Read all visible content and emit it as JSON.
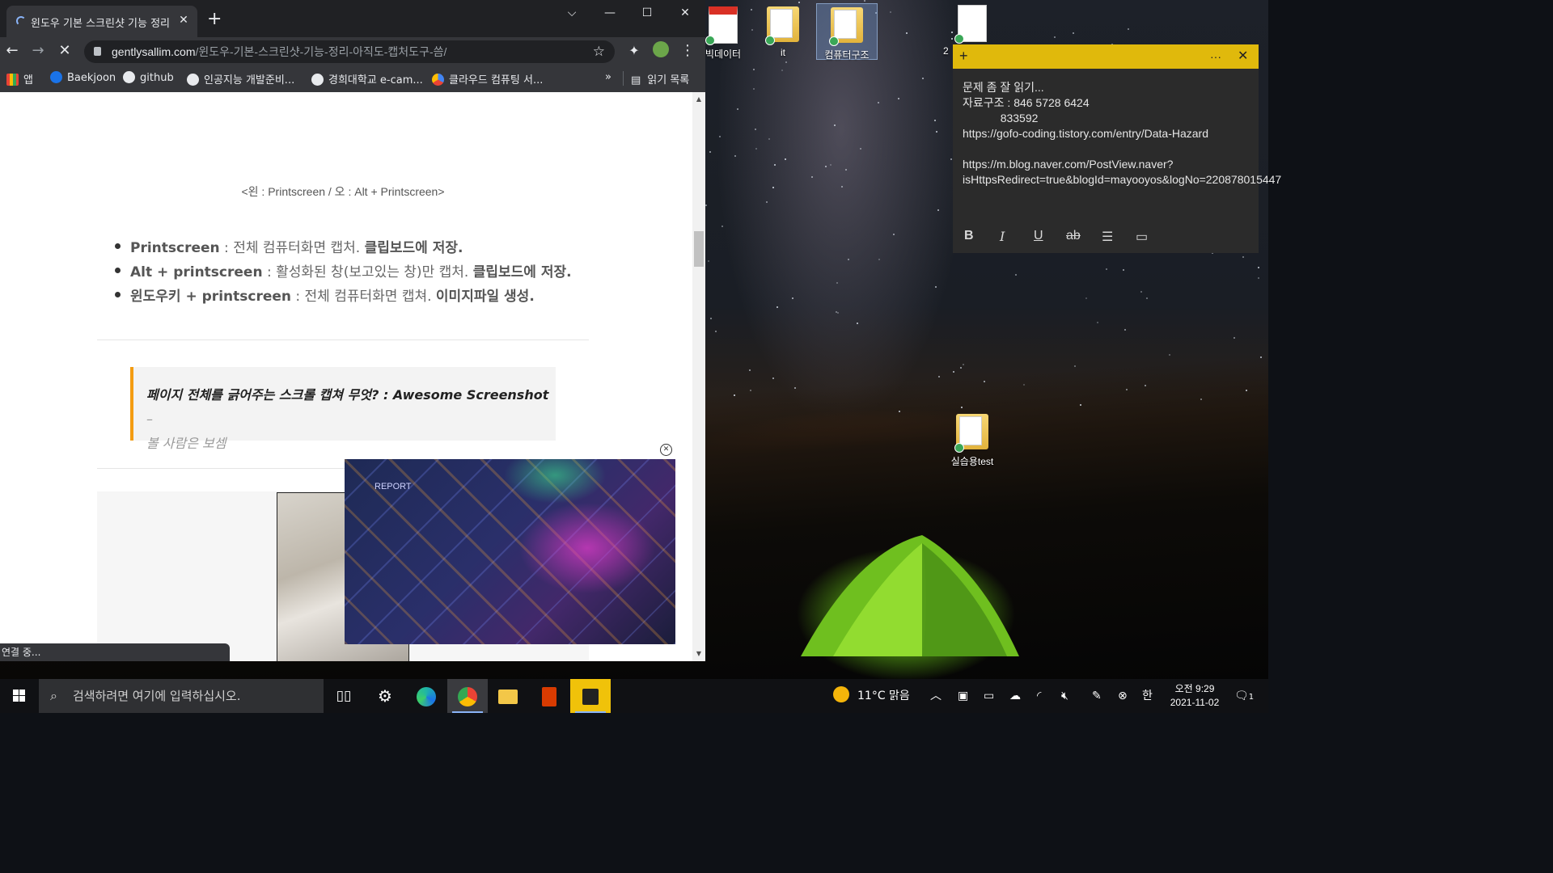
{
  "browser": {
    "tab_title": "윈도우 기본 스크린샷 기능 정리",
    "tab_close": "✕",
    "new_tab": "+",
    "window_controls": {
      "dropdown": "⌵",
      "minimize": "—",
      "maximize": "☐",
      "close": "✕"
    },
    "nav": {
      "back": "←",
      "forward": "→",
      "stop": "✕"
    },
    "url_host": "gentlysallim.com",
    "url_path": "/윈도우-기본-스크린샷-기능-정리-아직도-캡처도구-씀/",
    "bookmark_star": "☆",
    "bookmarks": [
      {
        "label": "앱",
        "icon": "apps-grid-icon"
      },
      {
        "label": "Baekjoon",
        "icon": "code-icon"
      },
      {
        "label": "github",
        "icon": "github-icon"
      },
      {
        "label": "인공지능 개발준비...",
        "icon": "globe-icon"
      },
      {
        "label": "경희대학교 e-cam...",
        "icon": "globe-icon"
      },
      {
        "label": "클라우드 컴퓨팅 서...",
        "icon": "google-cloud-icon"
      }
    ],
    "bookmarks_overflow": "»",
    "reading_list": "읽기 목록",
    "status": "연결 중..."
  },
  "article": {
    "caption": "<왼 : Printscreen / 오 : Alt + Printscreen>",
    "bullets": [
      {
        "key": "Printscreen",
        "sep": " : ",
        "text": "전체 컴퓨터화면 캡처. ",
        "emph": "클립보드에 저장."
      },
      {
        "key": "Alt + printscreen",
        "sep": " : ",
        "text": "활성화된 창(보고있는 창)만 캡처. ",
        "emph": "클립보드에 저장."
      },
      {
        "key": "윈도우키 + printscreen",
        "sep": " : ",
        "text": "전체 컴퓨터화면 캡쳐. ",
        "emph": "이미지파일 생성."
      }
    ],
    "quote_title": "페이지 전체를 긁어주는 스크롤 캡쳐 무엇? : Awesome Screenshot",
    "quote_dash": " –",
    "quote_sub": "볼 사람은 보셈",
    "ad_report": "REPORT",
    "ad_close": "✕"
  },
  "desktop_icons": [
    {
      "label": "빅데이터",
      "type": "pdf"
    },
    {
      "label": "it",
      "type": "folder"
    },
    {
      "label": "컴퓨터구조",
      "type": "folder"
    },
    {
      "label": "2",
      "type": "doc"
    },
    {
      "label": "실습용test",
      "type": "folder"
    }
  ],
  "sticky": {
    "add": "+",
    "menu": "···",
    "close": "✕",
    "body": "문제 좀 잘 읽기...\n자료구조 : 846 5728 6424\n            833592\nhttps://gofo-coding.tistory.com/entry/Data-Hazard\n\nhttps://m.blog.naver.com/PostView.naver?isHttpsRedirect=true&blogId=mayooyos&logNo=220878015447",
    "toolbar": {
      "bold": "B",
      "italic": "I",
      "underline": "U",
      "strike": "ab",
      "list": "☰",
      "image": "▭"
    }
  },
  "taskbar": {
    "search_placeholder": "검색하려면 여기에 입력하십시오.",
    "weather": "11°C 맑음",
    "ime": "한",
    "time": "오전 9:29",
    "date": "2021-11-02",
    "notifications": "1",
    "apps": [
      "task-view",
      "settings",
      "edge",
      "chrome",
      "file-explorer",
      "office",
      "sticky-notes"
    ]
  },
  "colors": {
    "chrome_dark": "#202124",
    "chrome_toolbar": "#35363a",
    "sticky_yellow": "#e0b90c",
    "quote_accent": "#f39c12",
    "taskbar": "#101114"
  }
}
